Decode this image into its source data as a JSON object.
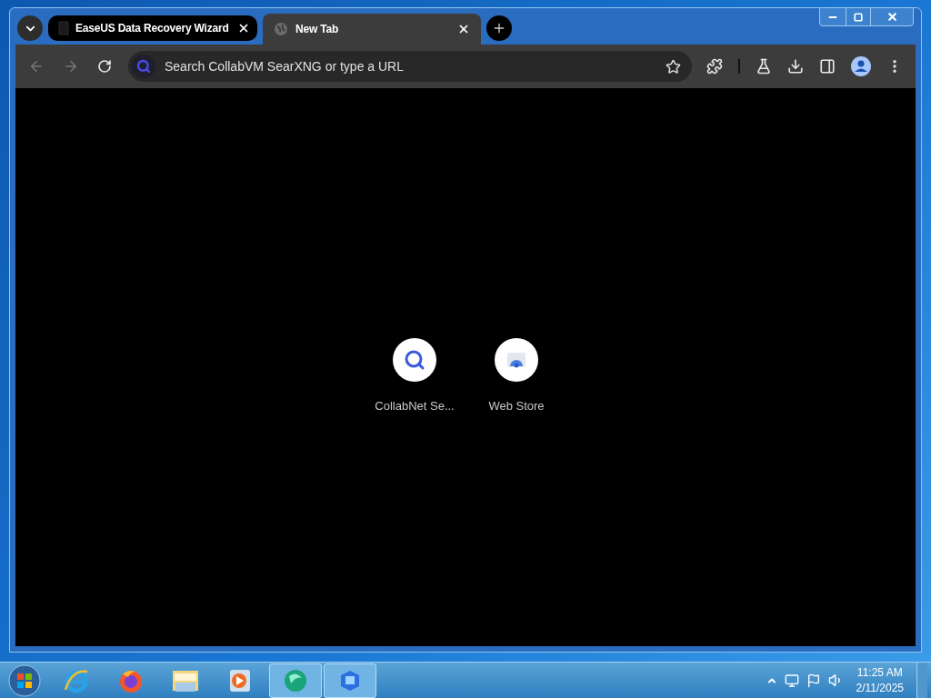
{
  "tabs": [
    {
      "title": "EaseUS Data Recovery Wizard",
      "selected": false
    },
    {
      "title": "New Tab",
      "selected": true
    }
  ],
  "address_bar": {
    "placeholder": "Search CollabVM SearXNG or type a URL"
  },
  "shortcuts": [
    {
      "kind": "search",
      "label": "CollabNet Se..."
    },
    {
      "kind": "store",
      "label": "Web Store"
    }
  ],
  "taskbar": {
    "items": [
      {
        "kind": "ie",
        "active": false
      },
      {
        "kind": "firefox",
        "active": false
      },
      {
        "kind": "explorer",
        "active": false
      },
      {
        "kind": "media",
        "active": false
      },
      {
        "kind": "easeus",
        "active": true
      },
      {
        "kind": "app",
        "active": true
      }
    ],
    "clock": {
      "time": "11:25 AM",
      "date": "2/11/2025"
    }
  }
}
